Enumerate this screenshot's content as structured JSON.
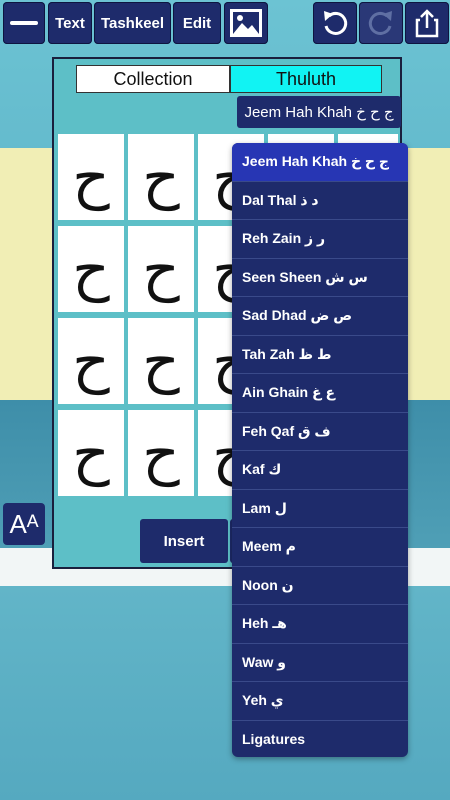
{
  "toolbar": {
    "menu_icon": "hamburger-menu-icon",
    "text_label": "Text",
    "tashkeel_label": "Tashkeel",
    "edit_label": "Edit",
    "image_icon": "image-icon",
    "undo_icon": "undo-icon",
    "redo_icon": "redo-icon",
    "share_icon": "share-icon"
  },
  "panel": {
    "tabs": {
      "collection": "Collection",
      "style": "Thuluth"
    },
    "current_group": "Jeem Hah Khah ج ح خ",
    "tiles": [
      "ح",
      "ح",
      "ح",
      "ح",
      "ح",
      "ح",
      "ح",
      "ح",
      "ح",
      "ح",
      "ح",
      "ح",
      "ح",
      "ح",
      "ح",
      "ح",
      "ح",
      "ح",
      "ح",
      "ح"
    ],
    "insert_label": "Insert"
  },
  "font_size_icon": "font-size-icon",
  "font_size_glyph": "Aᴬ",
  "dropdown": {
    "items": [
      "Jeem Hah Khah ج ح خ",
      "Dal Thal د ذ",
      "Reh Zain ر ز",
      "Seen Sheen س ش",
      "Sad Dhad ص ض",
      "Tah Zah ط ظ",
      "Ain Ghain ع غ",
      "Feh Qaf ف ق",
      "Kaf ك",
      "Lam ل",
      "Meem م",
      "Noon ن",
      "Heh هـ",
      "Waw و",
      "Yeh ي",
      "Ligatures"
    ],
    "selected_index": 0
  },
  "colors": {
    "button_bg": "#1e2b6b",
    "tab_active": "#11f3f3",
    "selected_item": "#2736b4"
  }
}
